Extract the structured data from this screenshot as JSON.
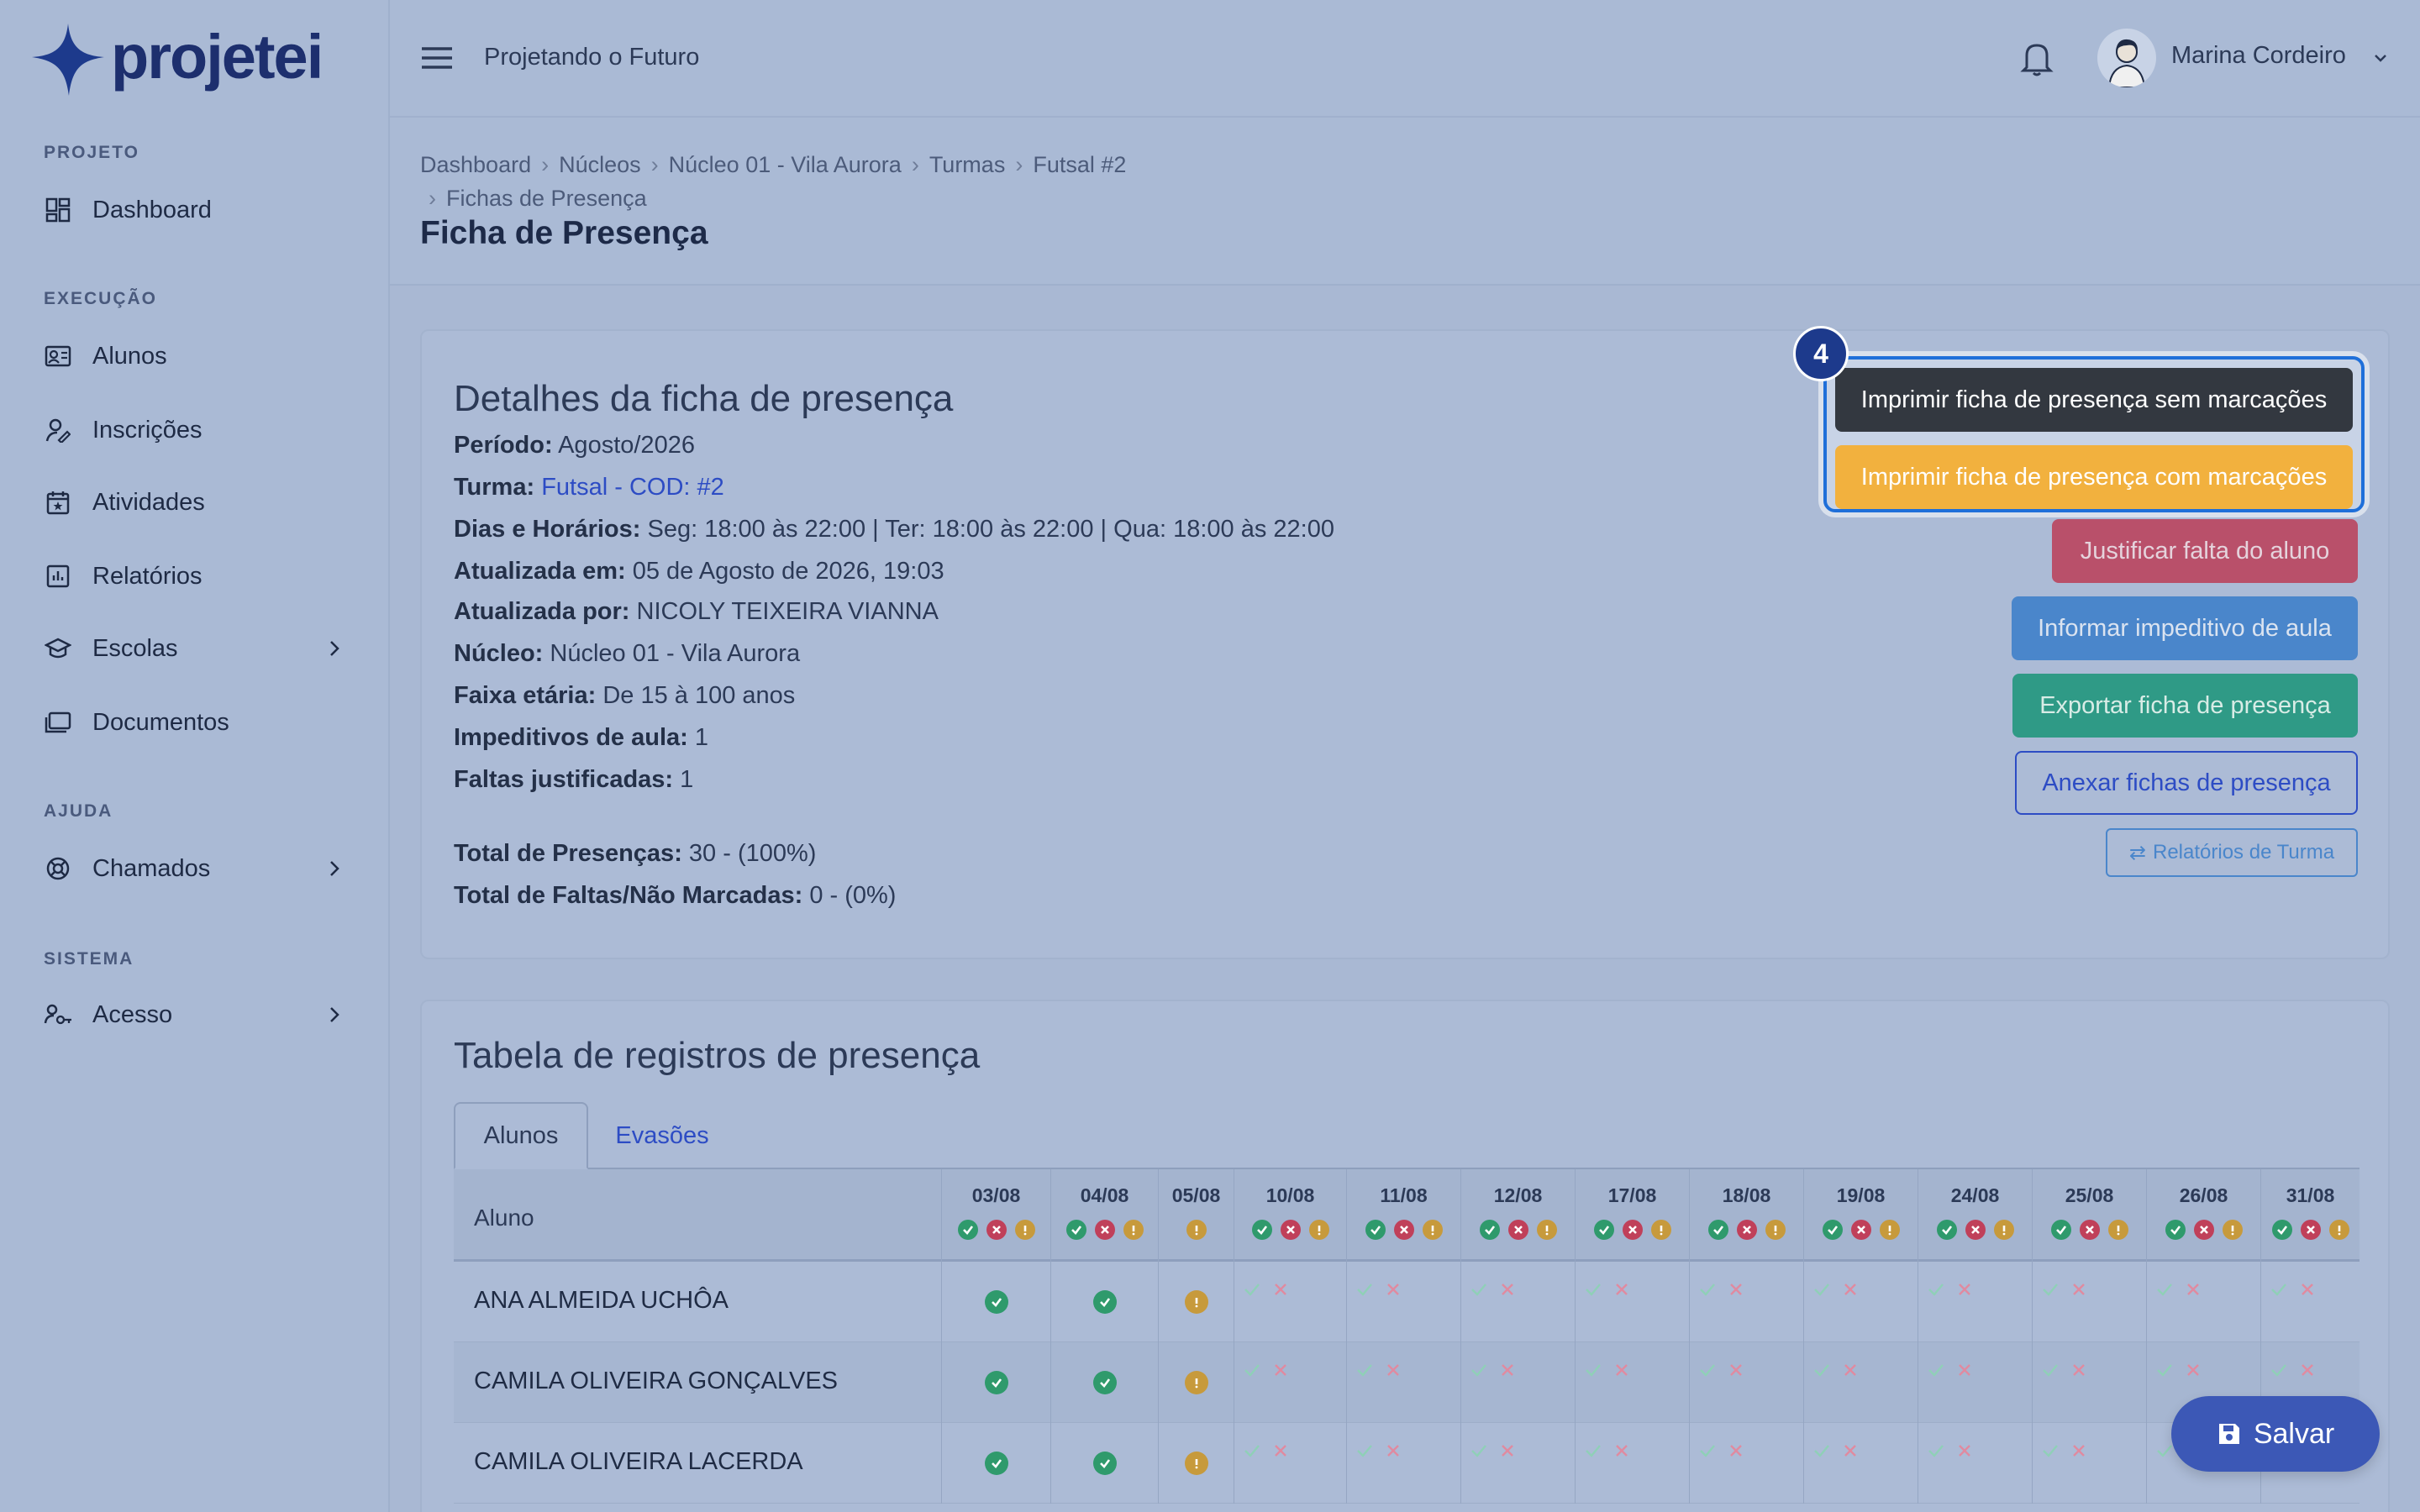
{
  "brand": {
    "name": "projetei",
    "accent": "#1d3a8c"
  },
  "sidebar": {
    "sections": [
      {
        "title": "PROJETO",
        "items": [
          {
            "label": "Dashboard",
            "icon": "dashboard-icon"
          }
        ]
      },
      {
        "title": "EXECUÇÃO",
        "items": [
          {
            "label": "Alunos",
            "icon": "id-card-icon"
          },
          {
            "label": "Inscrições",
            "icon": "user-edit-icon"
          },
          {
            "label": "Atividades",
            "icon": "calendar-icon"
          },
          {
            "label": "Relatórios",
            "icon": "chart-icon"
          },
          {
            "label": "Escolas",
            "icon": "graduation-cap-icon"
          },
          {
            "label": "Documentos",
            "icon": "folder-icon"
          }
        ]
      },
      {
        "title": "AJUDA",
        "items": [
          {
            "label": "Chamados",
            "icon": "lifebuoy-icon"
          }
        ]
      },
      {
        "title": "SISTEMA",
        "items": [
          {
            "label": "Acesso",
            "icon": "user-key-icon"
          }
        ]
      }
    ]
  },
  "topbar": {
    "project_name": "Projetando o Futuro",
    "user_name": "Marina Cordeiro"
  },
  "breadcrumb": [
    "Dashboard",
    "Núcleos",
    "Núcleo 01 - Vila Aurora",
    "Turmas",
    "Futsal #2",
    "Fichas de Presença"
  ],
  "page_title": "Ficha de Presença",
  "details": {
    "title": "Detalhes da ficha de presença",
    "periodo_label": "Período:",
    "periodo": "Agosto/2026",
    "turma_label": "Turma:",
    "turma": "Futsal - COD: #2",
    "dias_label": "Dias e Horários:",
    "dias": "Seg: 18:00 às 22:00 | Ter: 18:00 às 22:00 | Qua: 18:00 às 22:00",
    "atualizada_em_label": "Atualizada em:",
    "atualizada_em": "05 de Agosto de 2026, 19:03",
    "atualizada_por_label": "Atualizada por:",
    "atualizada_por": "NICOLY TEIXEIRA VIANNA",
    "nucleo_label": "Núcleo:",
    "nucleo": "Núcleo 01 - Vila Aurora",
    "faixa_label": "Faixa etária:",
    "faixa": "De 15 à 100 anos",
    "impeditivos_label": "Impeditivos de aula:",
    "impeditivos": "1",
    "faltas_just_label": "Faltas justificadas:",
    "faltas_just": "1",
    "total_presencas_label": "Total de Presenças:",
    "total_presencas": "30 - (100%)",
    "total_faltas_label": "Total de Faltas/Não Marcadas:",
    "total_faltas": "0 - (0%)"
  },
  "actions": {
    "print_blank": "Imprimir ficha de presença sem marcações",
    "print_marked": "Imprimir ficha de presença com marcações",
    "justify": "Justificar falta do aluno",
    "impediment": "Informar impeditivo de aula",
    "export": "Exportar ficha de presença",
    "attach": "Anexar fichas de presença",
    "reports": "Relatórios de Turma",
    "step_number": "4"
  },
  "table": {
    "title": "Tabela de registros de presença",
    "tabs": [
      "Alunos",
      "Evasões"
    ],
    "column_aluno": "Aluno",
    "dates": [
      "03/08",
      "04/08",
      "05/08",
      "10/08",
      "11/08",
      "12/08",
      "17/08",
      "18/08",
      "19/08",
      "24/08",
      "25/08",
      "26/08",
      "31/08"
    ],
    "rows": [
      {
        "name": "ANA ALMEIDA UCHÔA",
        "marks": [
          "present",
          "present",
          "impediment",
          "none",
          "none",
          "none",
          "none",
          "none",
          "none",
          "none",
          "none",
          "none",
          "none"
        ]
      },
      {
        "name": "CAMILA OLIVEIRA GONÇALVES",
        "marks": [
          "present",
          "present",
          "impediment",
          "none",
          "none",
          "none",
          "none",
          "none",
          "none",
          "none",
          "none",
          "none",
          "none"
        ]
      },
      {
        "name": "CAMILA OLIVEIRA LACERDA",
        "marks": [
          "present",
          "present",
          "impediment",
          "none",
          "none",
          "none",
          "none",
          "none",
          "none",
          "none",
          "none",
          "none",
          "none"
        ]
      }
    ]
  },
  "save_label": "Salvar"
}
